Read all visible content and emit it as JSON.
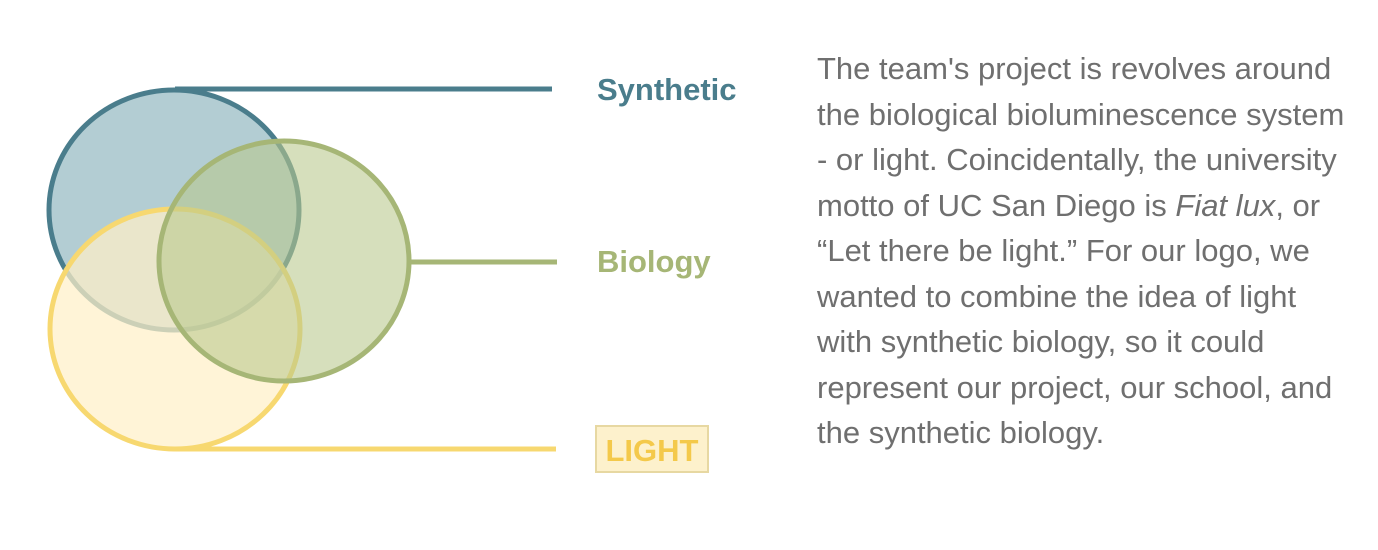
{
  "colors": {
    "synthetic": "#4a7d8c",
    "synthetic_fill": "#a9c6cd",
    "biology": "#a6b676",
    "biology_fill": "#c4d1a1",
    "light": "#f7d870",
    "light_fill": "#fff0c8",
    "light_label_bg": "#fdf1cc",
    "text": "#6f6f6f"
  },
  "labels": {
    "synthetic": "Synthetic",
    "biology": "Biology",
    "light": "LIGHT"
  },
  "description": {
    "part1": "The team's project is revolves around the biological bioluminescence system - or light. Coincidentally, the university motto of UC San Diego is ",
    "motto": "Fiat lux",
    "part2": ", or “Let there be light.” For our logo, we wanted to combine the idea of light with synthetic biology, so it could represent our project, our school, and the synthetic biology."
  }
}
